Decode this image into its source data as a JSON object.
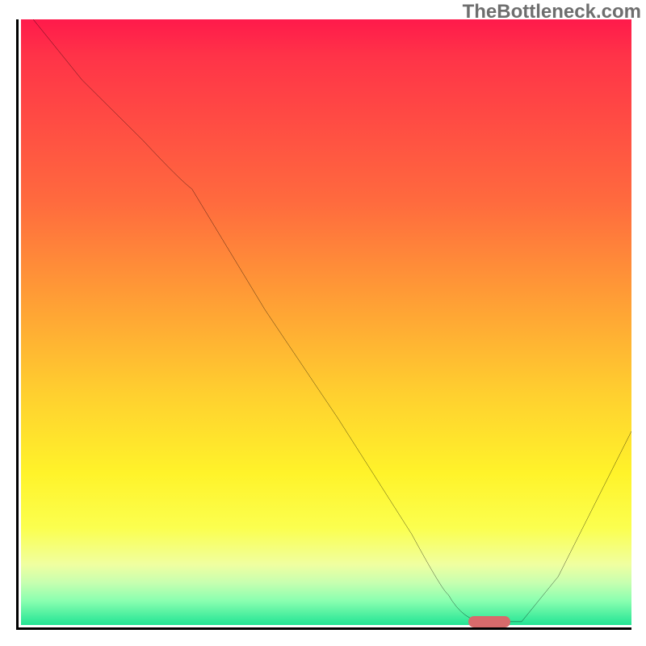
{
  "watermark": "TheBottleneck.com",
  "chart_data": {
    "type": "line",
    "title": "",
    "xlabel": "",
    "ylabel": "",
    "xlim": [
      0,
      100
    ],
    "ylim": [
      0,
      100
    ],
    "grid": false,
    "legend": false,
    "background": {
      "kind": "vertical-gradient",
      "stops": [
        {
          "pct": 0,
          "color": "#ff1a4b"
        },
        {
          "pct": 6,
          "color": "#ff3348"
        },
        {
          "pct": 30,
          "color": "#ff6a3e"
        },
        {
          "pct": 45,
          "color": "#ff9a36"
        },
        {
          "pct": 62,
          "color": "#ffd02f"
        },
        {
          "pct": 75,
          "color": "#fff32a"
        },
        {
          "pct": 84,
          "color": "#fbff4f"
        },
        {
          "pct": 90,
          "color": "#f0ffa0"
        },
        {
          "pct": 93,
          "color": "#c7ffb0"
        },
        {
          "pct": 96,
          "color": "#8affb0"
        },
        {
          "pct": 100,
          "color": "#22e494"
        }
      ]
    },
    "series": [
      {
        "name": "curve",
        "x": [
          2,
          10,
          20,
          28,
          40,
          52,
          64,
          70,
          76,
          82,
          88,
          94,
          100
        ],
        "y": [
          100,
          90,
          80,
          72,
          52,
          34,
          15,
          5,
          0,
          0,
          8,
          20,
          32
        ],
        "color": "#000000",
        "width": 2
      }
    ],
    "marker": {
      "name": "optimal-range",
      "x_center": 77,
      "y": 0.8,
      "width_pct": 7,
      "color": "#d76a6b"
    }
  }
}
